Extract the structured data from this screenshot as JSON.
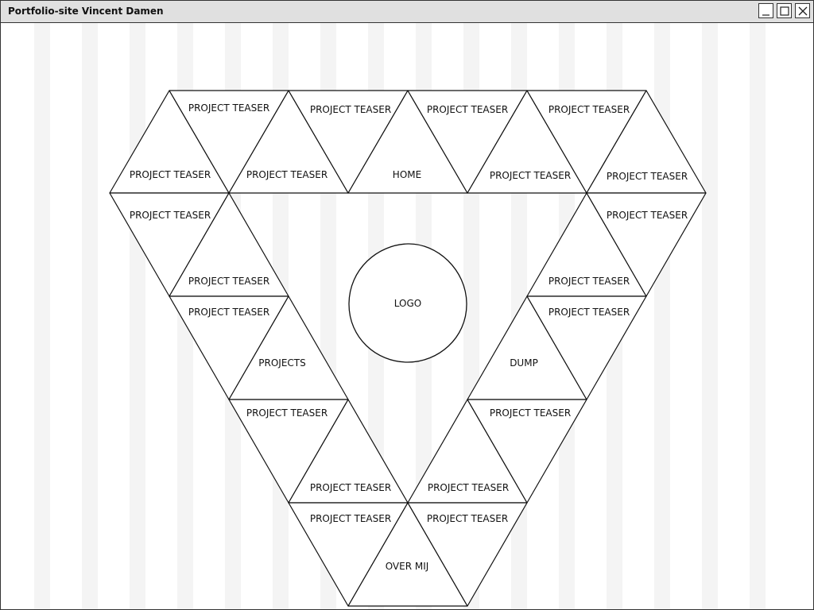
{
  "window": {
    "title": "Portfolio-site Vincent Damen",
    "controls": {
      "minimize": "minimize-icon",
      "maximize": "maximize-icon",
      "close": "close-icon"
    }
  },
  "layout": {
    "logo": "LOGO",
    "nav": {
      "home": "HOME",
      "projects": "PROJECTS",
      "dump": "DUMP",
      "over_mij": "OVER MIJ"
    },
    "teaser_label": "PROJECT TEASER"
  }
}
